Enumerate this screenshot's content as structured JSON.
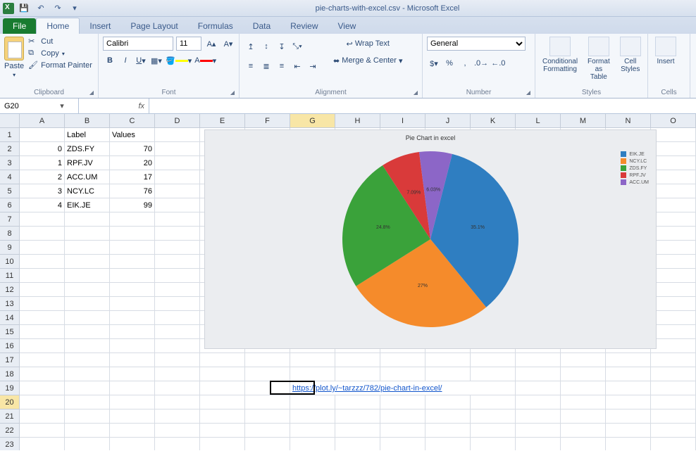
{
  "app": {
    "title": "pie-charts-with-excel.csv - Microsoft Excel"
  },
  "tabs": {
    "file": "File",
    "items": [
      "Home",
      "Insert",
      "Page Layout",
      "Formulas",
      "Data",
      "Review",
      "View"
    ],
    "active": "Home"
  },
  "ribbon": {
    "clipboard": {
      "group": "Clipboard",
      "paste": "Paste",
      "cut": "Cut",
      "copy": "Copy",
      "format_painter": "Format Painter"
    },
    "font": {
      "group": "Font",
      "name": "Calibri",
      "size": "11"
    },
    "alignment": {
      "group": "Alignment",
      "wrap": "Wrap Text",
      "merge": "Merge & Center"
    },
    "number": {
      "group": "Number",
      "format": "General"
    },
    "styles": {
      "group": "Styles",
      "cond": "Conditional\nFormatting",
      "table": "Format\nas Table",
      "cell": "Cell\nStyles"
    },
    "cells": {
      "group": "Cells",
      "insert": "Insert"
    }
  },
  "namebox": "G20",
  "formula": "",
  "columns": [
    "A",
    "B",
    "C",
    "D",
    "E",
    "F",
    "G",
    "H",
    "I",
    "J",
    "K",
    "L",
    "M",
    "N",
    "O"
  ],
  "row_count": 23,
  "active_cell": {
    "col": 6,
    "row": 19
  },
  "active_col": 6,
  "active_row": 19,
  "sheet": {
    "headers": {
      "b": "Label",
      "c": "Values"
    },
    "rows": [
      {
        "a": "0",
        "b": "ZDS.FY",
        "c": "70"
      },
      {
        "a": "1",
        "b": "RPF.JV",
        "c": "20"
      },
      {
        "a": "2",
        "b": "ACC.UM",
        "c": "17"
      },
      {
        "a": "3",
        "b": "NCY.LC",
        "c": "76"
      },
      {
        "a": "4",
        "b": "EIK.JE",
        "c": "99"
      }
    ],
    "link_cell": "https://plot.ly/~tarzzz/782/pie-chart-in-excel/"
  },
  "chart_data": {
    "type": "pie",
    "title": "Pie Chart in excel",
    "series": [
      {
        "name": "EIK.JE",
        "value": 99,
        "pct": 35.1,
        "color": "#2f7ec1"
      },
      {
        "name": "NCY.LC",
        "value": 76,
        "pct": 27.0,
        "color": "#f58b2b"
      },
      {
        "name": "ZDS.FY",
        "value": 70,
        "pct": 24.8,
        "color": "#3aa23a"
      },
      {
        "name": "RPF.JV",
        "value": 20,
        "pct": 7.1,
        "color": "#d93a3a"
      },
      {
        "name": "ACC.UM",
        "value": 17,
        "pct": 6.0,
        "color": "#8c66c7"
      }
    ],
    "labels": {
      "eik": "35.1%",
      "ncy": "27%",
      "zds": "24.8%",
      "rpf": "7.09%",
      "acc": "6.03%"
    }
  }
}
